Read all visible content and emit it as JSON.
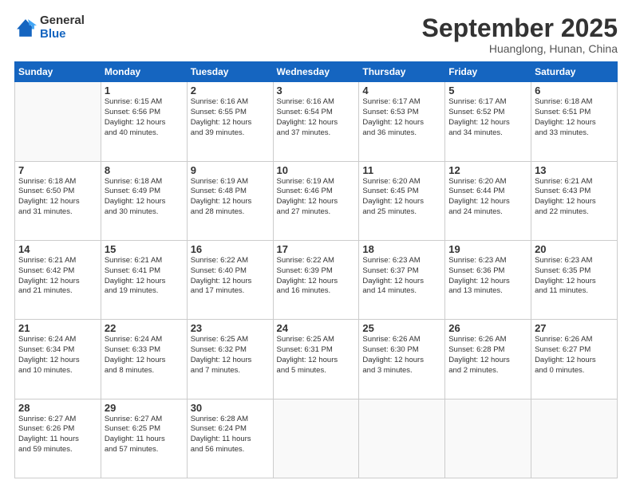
{
  "logo": {
    "general": "General",
    "blue": "Blue"
  },
  "header": {
    "month": "September 2025",
    "location": "Huanglong, Hunan, China"
  },
  "days_header": [
    "Sunday",
    "Monday",
    "Tuesday",
    "Wednesday",
    "Thursday",
    "Friday",
    "Saturday"
  ],
  "weeks": [
    [
      {
        "num": "",
        "info": ""
      },
      {
        "num": "1",
        "info": "Sunrise: 6:15 AM\nSunset: 6:56 PM\nDaylight: 12 hours\nand 40 minutes."
      },
      {
        "num": "2",
        "info": "Sunrise: 6:16 AM\nSunset: 6:55 PM\nDaylight: 12 hours\nand 39 minutes."
      },
      {
        "num": "3",
        "info": "Sunrise: 6:16 AM\nSunset: 6:54 PM\nDaylight: 12 hours\nand 37 minutes."
      },
      {
        "num": "4",
        "info": "Sunrise: 6:17 AM\nSunset: 6:53 PM\nDaylight: 12 hours\nand 36 minutes."
      },
      {
        "num": "5",
        "info": "Sunrise: 6:17 AM\nSunset: 6:52 PM\nDaylight: 12 hours\nand 34 minutes."
      },
      {
        "num": "6",
        "info": "Sunrise: 6:18 AM\nSunset: 6:51 PM\nDaylight: 12 hours\nand 33 minutes."
      }
    ],
    [
      {
        "num": "7",
        "info": "Sunrise: 6:18 AM\nSunset: 6:50 PM\nDaylight: 12 hours\nand 31 minutes."
      },
      {
        "num": "8",
        "info": "Sunrise: 6:18 AM\nSunset: 6:49 PM\nDaylight: 12 hours\nand 30 minutes."
      },
      {
        "num": "9",
        "info": "Sunrise: 6:19 AM\nSunset: 6:48 PM\nDaylight: 12 hours\nand 28 minutes."
      },
      {
        "num": "10",
        "info": "Sunrise: 6:19 AM\nSunset: 6:46 PM\nDaylight: 12 hours\nand 27 minutes."
      },
      {
        "num": "11",
        "info": "Sunrise: 6:20 AM\nSunset: 6:45 PM\nDaylight: 12 hours\nand 25 minutes."
      },
      {
        "num": "12",
        "info": "Sunrise: 6:20 AM\nSunset: 6:44 PM\nDaylight: 12 hours\nand 24 minutes."
      },
      {
        "num": "13",
        "info": "Sunrise: 6:21 AM\nSunset: 6:43 PM\nDaylight: 12 hours\nand 22 minutes."
      }
    ],
    [
      {
        "num": "14",
        "info": "Sunrise: 6:21 AM\nSunset: 6:42 PM\nDaylight: 12 hours\nand 21 minutes."
      },
      {
        "num": "15",
        "info": "Sunrise: 6:21 AM\nSunset: 6:41 PM\nDaylight: 12 hours\nand 19 minutes."
      },
      {
        "num": "16",
        "info": "Sunrise: 6:22 AM\nSunset: 6:40 PM\nDaylight: 12 hours\nand 17 minutes."
      },
      {
        "num": "17",
        "info": "Sunrise: 6:22 AM\nSunset: 6:39 PM\nDaylight: 12 hours\nand 16 minutes."
      },
      {
        "num": "18",
        "info": "Sunrise: 6:23 AM\nSunset: 6:37 PM\nDaylight: 12 hours\nand 14 minutes."
      },
      {
        "num": "19",
        "info": "Sunrise: 6:23 AM\nSunset: 6:36 PM\nDaylight: 12 hours\nand 13 minutes."
      },
      {
        "num": "20",
        "info": "Sunrise: 6:23 AM\nSunset: 6:35 PM\nDaylight: 12 hours\nand 11 minutes."
      }
    ],
    [
      {
        "num": "21",
        "info": "Sunrise: 6:24 AM\nSunset: 6:34 PM\nDaylight: 12 hours\nand 10 minutes."
      },
      {
        "num": "22",
        "info": "Sunrise: 6:24 AM\nSunset: 6:33 PM\nDaylight: 12 hours\nand 8 minutes."
      },
      {
        "num": "23",
        "info": "Sunrise: 6:25 AM\nSunset: 6:32 PM\nDaylight: 12 hours\nand 7 minutes."
      },
      {
        "num": "24",
        "info": "Sunrise: 6:25 AM\nSunset: 6:31 PM\nDaylight: 12 hours\nand 5 minutes."
      },
      {
        "num": "25",
        "info": "Sunrise: 6:26 AM\nSunset: 6:30 PM\nDaylight: 12 hours\nand 3 minutes."
      },
      {
        "num": "26",
        "info": "Sunrise: 6:26 AM\nSunset: 6:28 PM\nDaylight: 12 hours\nand 2 minutes."
      },
      {
        "num": "27",
        "info": "Sunrise: 6:26 AM\nSunset: 6:27 PM\nDaylight: 12 hours\nand 0 minutes."
      }
    ],
    [
      {
        "num": "28",
        "info": "Sunrise: 6:27 AM\nSunset: 6:26 PM\nDaylight: 11 hours\nand 59 minutes."
      },
      {
        "num": "29",
        "info": "Sunrise: 6:27 AM\nSunset: 6:25 PM\nDaylight: 11 hours\nand 57 minutes."
      },
      {
        "num": "30",
        "info": "Sunrise: 6:28 AM\nSunset: 6:24 PM\nDaylight: 11 hours\nand 56 minutes."
      },
      {
        "num": "",
        "info": ""
      },
      {
        "num": "",
        "info": ""
      },
      {
        "num": "",
        "info": ""
      },
      {
        "num": "",
        "info": ""
      }
    ]
  ]
}
